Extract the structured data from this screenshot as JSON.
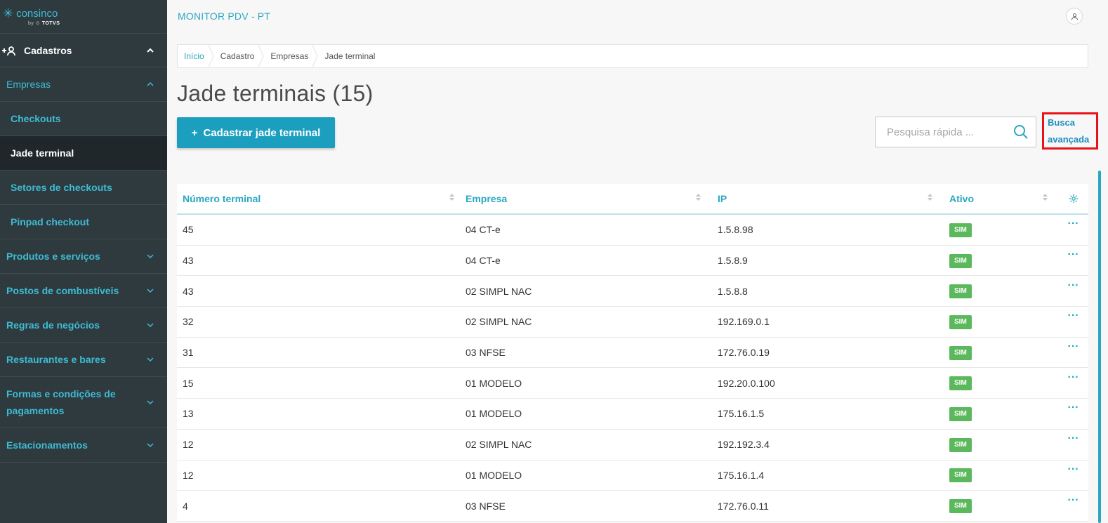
{
  "sidebar": {
    "brand": "consinco",
    "brand_sub_prefix": "by",
    "brand_sub_name": "TOTVS",
    "section": "Cadastros",
    "items": [
      {
        "label": "Empresas"
      },
      {
        "label": "Checkouts"
      },
      {
        "label": "Jade terminal"
      },
      {
        "label": "Setores de checkouts"
      },
      {
        "label": "Pinpad checkout"
      },
      {
        "label": "Produtos e serviços"
      },
      {
        "label": "Postos de combustíveis"
      },
      {
        "label": "Regras de negócios"
      },
      {
        "label": "Restaurantes e bares"
      },
      {
        "label": "Formas e condições de pagamentos"
      },
      {
        "label": "Estacionamentos"
      }
    ]
  },
  "header": {
    "app_title": "MONITOR PDV - PT"
  },
  "breadcrumb": [
    "Início",
    "Cadastro",
    "Empresas",
    "Jade terminal"
  ],
  "page": {
    "title": "Jade terminais (15)",
    "add_button": "Cadastrar jade terminal",
    "search_placeholder": "Pesquisa rápida ...",
    "advanced_search_line1": "Busca",
    "advanced_search_line2": "avançada"
  },
  "table": {
    "columns": [
      "Número terminal",
      "Empresa",
      "IP",
      "Ativo"
    ],
    "rows": [
      {
        "numero": "45",
        "empresa": "04 CT-e",
        "ip": "1.5.8.98",
        "ativo": "SIM"
      },
      {
        "numero": "43",
        "empresa": "04 CT-e",
        "ip": "1.5.8.9",
        "ativo": "SIM"
      },
      {
        "numero": "43",
        "empresa": "02 SIMPL NAC",
        "ip": "1.5.8.8",
        "ativo": "SIM"
      },
      {
        "numero": "32",
        "empresa": "02 SIMPL NAC",
        "ip": "192.169.0.1",
        "ativo": "SIM"
      },
      {
        "numero": "31",
        "empresa": "03 NFSE",
        "ip": "172.76.0.19",
        "ativo": "SIM"
      },
      {
        "numero": "15",
        "empresa": "01 MODELO",
        "ip": "192.20.0.100",
        "ativo": "SIM"
      },
      {
        "numero": "13",
        "empresa": "01 MODELO",
        "ip": "175.16.1.5",
        "ativo": "SIM"
      },
      {
        "numero": "12",
        "empresa": "02 SIMPL NAC",
        "ip": "192.192.3.4",
        "ativo": "SIM"
      },
      {
        "numero": "12",
        "empresa": "01 MODELO",
        "ip": "175.16.1.4",
        "ativo": "SIM"
      },
      {
        "numero": "4",
        "empresa": "03 NFSE",
        "ip": "172.76.0.11",
        "ativo": "SIM"
      }
    ],
    "row_action": "···"
  },
  "colors": {
    "accent": "#2aa7c0",
    "button": "#1c9fbf",
    "sidebar_bg": "#2f3a3f",
    "sidebar_active": "#1f272a",
    "badge": "#5cb85c",
    "highlight": "#e8121a"
  }
}
